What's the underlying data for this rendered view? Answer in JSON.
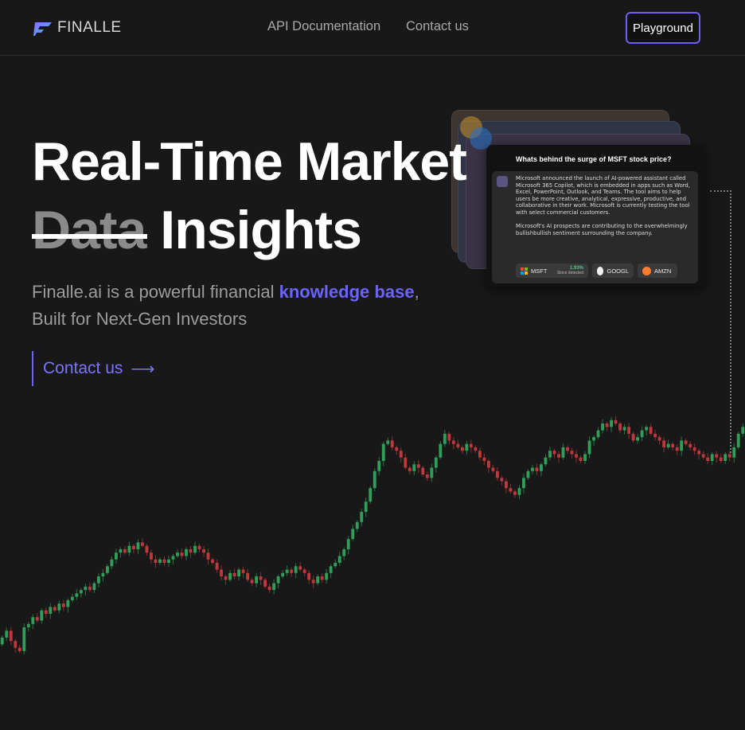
{
  "header": {
    "logo_text": "FINALLE",
    "nav": [
      {
        "label": "API Documentation"
      },
      {
        "label": "Contact us"
      }
    ],
    "playground_label": "Playground"
  },
  "hero": {
    "title_line1": "Real-Time Market",
    "title_strike": "Data",
    "title_rest": "Insights",
    "subtitle_prefix": "Finalle.ai is a powerful financial ",
    "subtitle_highlight": "knowledge base",
    "subtitle_suffix": ",",
    "subtitle_line2": "Built for Next-Gen Investors",
    "cta_label": "Contact us",
    "cta_arrow": "⟶"
  },
  "insight_card": {
    "question": "Whats behind the surge of MSFT stock price?",
    "paragraph1": "Microsoft announced the launch of AI-powered assistant called Microsoft 365 Copilot, which is embedded in apps such as Word, Excel, PowerPoint, Outlook, and Teams. The tool aims to help users be more creative, analytical, expressive, productive, and  collaborative in their work. Microsoft is currently testing the tool with select commercial customers.",
    "paragraph2": "Microsoft's AI prospects are contributing to the overwhelmingly bullishbullish sentiment surrounding the company.",
    "tickers": [
      {
        "symbol": "MSFT",
        "change": "1.93%",
        "note": "Since detected"
      },
      {
        "symbol": "GOOGL"
      },
      {
        "symbol": "AMZN"
      }
    ]
  },
  "colors": {
    "accent": "#6c63ff",
    "up": "#2f9e58",
    "down": "#c0383c",
    "background": "#181818"
  },
  "icons": {
    "logo": "finalle-logo-icon",
    "cta": "arrow-right-icon"
  },
  "chart_data": {
    "type": "candlestick",
    "closes": [
      48,
      50,
      47,
      45,
      44,
      51,
      52,
      54,
      53,
      56,
      55,
      57,
      56,
      58,
      57,
      59,
      60,
      61,
      62,
      63,
      62,
      64,
      66,
      67,
      69,
      71,
      73,
      74,
      73,
      75,
      74,
      76,
      75,
      73,
      71,
      70,
      71,
      70,
      71,
      72,
      73,
      72,
      74,
      73,
      75,
      74,
      73,
      71,
      70,
      68,
      66,
      65,
      67,
      66,
      68,
      67,
      65,
      64,
      66,
      65,
      63,
      62,
      64,
      66,
      67,
      68,
      67,
      69,
      68,
      67,
      65,
      64,
      66,
      65,
      67,
      69,
      70,
      72,
      74,
      77,
      80,
      82,
      85,
      88,
      92,
      97,
      100,
      105,
      106,
      104,
      103,
      101,
      98,
      97,
      99,
      98,
      96,
      95,
      98,
      101,
      105,
      108,
      106,
      105,
      104,
      103,
      105,
      104,
      103,
      101,
      100,
      98,
      97,
      95,
      94,
      92,
      91,
      90,
      92,
      95,
      97,
      98,
      97,
      99,
      101,
      103,
      102,
      101,
      104,
      103,
      102,
      101,
      100,
      102,
      106,
      107,
      109,
      111,
      110,
      112,
      111,
      109,
      110,
      108,
      106,
      107,
      109,
      110,
      108,
      107,
      106,
      104,
      105,
      104,
      103,
      106,
      105,
      104,
      103,
      102,
      101,
      100,
      102,
      101,
      100,
      102,
      101,
      104,
      108,
      110
    ]
  }
}
